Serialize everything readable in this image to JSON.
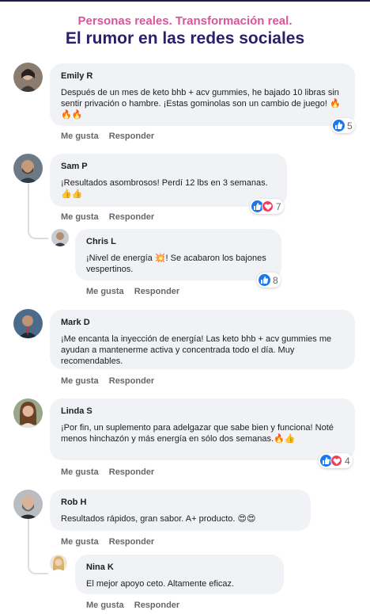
{
  "header": {
    "tagline": "Personas reales. Transformación real.",
    "title": "El rumor en las redes sociales"
  },
  "labels": {
    "like": "Me gusta",
    "reply": "Responder"
  },
  "comments": [
    {
      "name": "Emily R",
      "text": "Después de un mes de keto bhb + acv gummies, he bajado 10 libras sin sentir privación o hambre. ¡Estas gominolas son un cambio de juego! 🔥🔥🔥",
      "reactions": [
        "like"
      ],
      "count": "5"
    },
    {
      "name": "Sam P",
      "text": "¡Resultados asombrosos! Perdí 12 lbs en 3 semanas. 👍👍",
      "reactions": [
        "like",
        "love"
      ],
      "count": "7"
    },
    {
      "name": "Chris L",
      "text": "¡Nivel de energía 💥! Se acabaron los bajones vespertinos.",
      "reactions": [
        "like"
      ],
      "count": "8"
    },
    {
      "name": "Mark D",
      "text": "¡Me encanta la inyección de energía! Las keto bhb + acv gummies me ayudan a mantenerme activa y concentrada todo el día. Muy recomendables.",
      "reactions": [],
      "count": ""
    },
    {
      "name": "Linda S",
      "text": "¡Por fin, un suplemento para adelgazar que sabe bien y funciona! Noté menos hinchazón y más energía en sólo dos semanas.🔥👍",
      "reactions": [
        "like",
        "love"
      ],
      "count": "4"
    },
    {
      "name": "Rob H",
      "text": "Resultados rápidos, gran sabor. A+ producto. 😍😍",
      "reactions": [],
      "count": ""
    },
    {
      "name": "Nina K",
      "text": "El mejor apoyo ceto. Altamente eficaz.",
      "reactions": [],
      "count": ""
    }
  ],
  "colors": {
    "tagline": "#d4579a",
    "title": "#2d1e6b",
    "bubble": "#f0f2f5",
    "like": "#1877f2",
    "love": "#f33e58"
  }
}
